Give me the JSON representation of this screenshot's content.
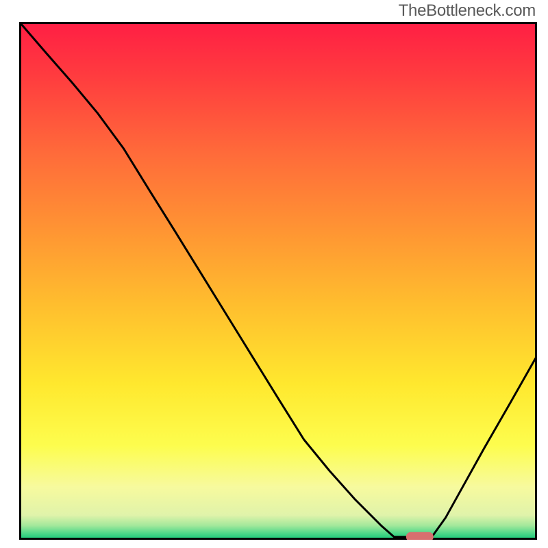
{
  "watermark": "TheBottleneck.com",
  "chart_data": {
    "type": "line",
    "title": "",
    "xlabel": "",
    "ylabel": "",
    "xlim": [
      0,
      1
    ],
    "ylim": [
      0,
      1
    ],
    "x": [
      0.0,
      0.05,
      0.1,
      0.15,
      0.2,
      0.25,
      0.3,
      0.35,
      0.4,
      0.45,
      0.5,
      0.55,
      0.6,
      0.65,
      0.7,
      0.725,
      0.75,
      0.78,
      0.8,
      0.825,
      0.85,
      0.9,
      0.95,
      1.0
    ],
    "y": [
      1.0,
      0.942,
      0.885,
      0.825,
      0.757,
      0.676,
      0.596,
      0.515,
      0.434,
      0.353,
      0.272,
      0.192,
      0.131,
      0.075,
      0.025,
      0.003,
      0.003,
      0.003,
      0.005,
      0.04,
      0.085,
      0.175,
      0.262,
      0.35
    ],
    "marker": {
      "x": 0.775,
      "y": 0.003,
      "color": "#d86f6f"
    },
    "gradient_stops": [
      {
        "offset": 0.0,
        "color": "#ff1f44"
      },
      {
        "offset": 0.1,
        "color": "#ff3b3f"
      },
      {
        "offset": 0.25,
        "color": "#ff6a3a"
      },
      {
        "offset": 0.4,
        "color": "#ff9433"
      },
      {
        "offset": 0.55,
        "color": "#ffbf2e"
      },
      {
        "offset": 0.7,
        "color": "#ffe82e"
      },
      {
        "offset": 0.82,
        "color": "#fdfd4e"
      },
      {
        "offset": 0.9,
        "color": "#f7fa9e"
      },
      {
        "offset": 0.955,
        "color": "#e0f3aa"
      },
      {
        "offset": 0.975,
        "color": "#a3e89b"
      },
      {
        "offset": 0.99,
        "color": "#4ed889"
      },
      {
        "offset": 1.0,
        "color": "#1fc97a"
      }
    ]
  }
}
